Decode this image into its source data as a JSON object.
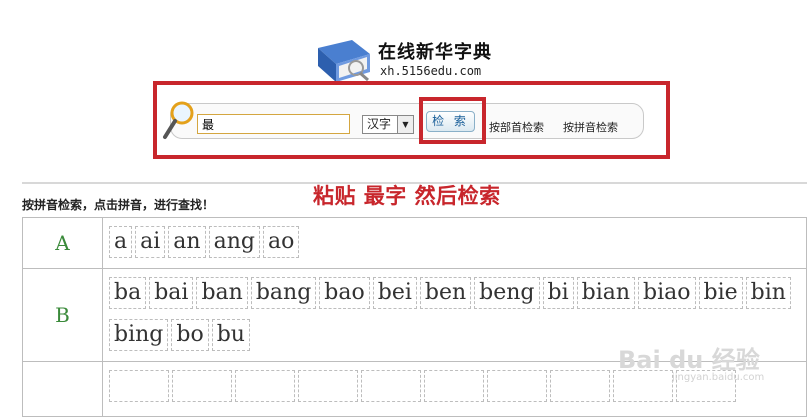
{
  "header": {
    "site_title": "在线新华字典",
    "site_url": "xh.5156edu.com"
  },
  "search": {
    "query": "最",
    "type_selected": "汉字",
    "button_label": "检 索",
    "link_radical": "按部首检索",
    "link_pinyin": "按拼音检索"
  },
  "annotation": {
    "instruction": "粘贴 最字 然后检索"
  },
  "section": {
    "header": "按拼音检索，点击拼音，进行查找！"
  },
  "pinyin_rows": [
    {
      "letter": "A",
      "items": [
        "a",
        "ai",
        "an",
        "ang",
        "ao"
      ]
    },
    {
      "letter": "B",
      "items": [
        "ba",
        "bai",
        "ban",
        "bang",
        "bao",
        "bei",
        "ben",
        "beng",
        "bi",
        "bian",
        "biao",
        "bie",
        "bin",
        "bing",
        "bo",
        "bu"
      ]
    },
    {
      "letter": "",
      "items": [
        "",
        "",
        "",
        "",
        "",
        "",
        "",
        "",
        "",
        ""
      ]
    }
  ],
  "watermark": {
    "brand": "Bai du 经验",
    "url": "jingyan.baidu.com"
  },
  "colors": {
    "annotation_red": "#c8262c",
    "letter_green": "#3a8a3a",
    "button_text": "#1a5f99"
  }
}
